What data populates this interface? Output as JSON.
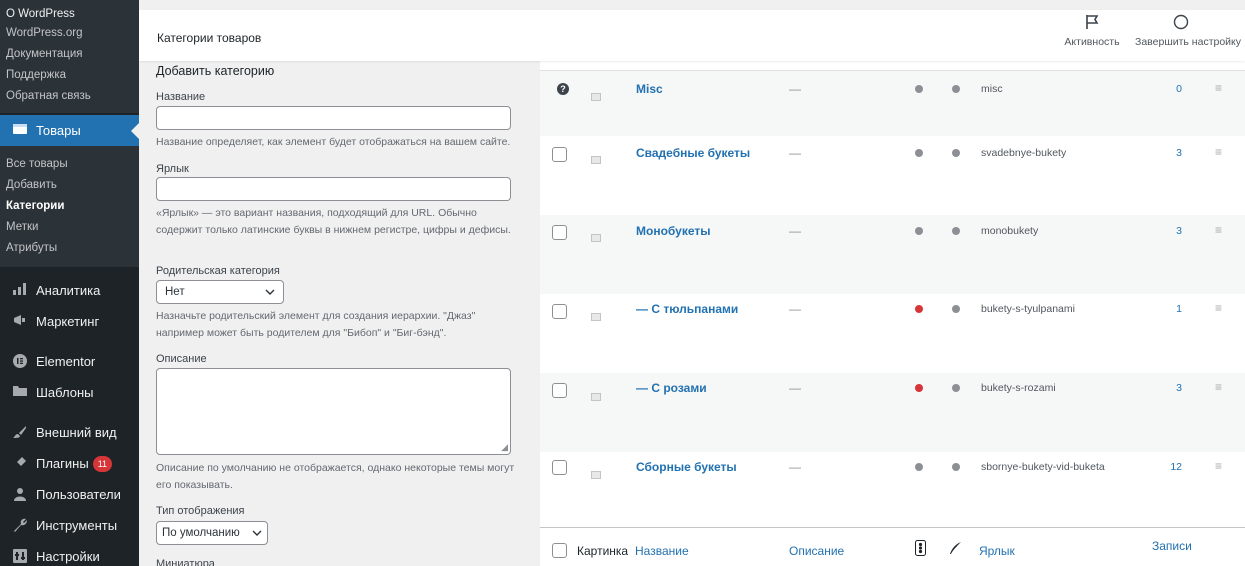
{
  "sidebar": {
    "top_sub": {
      "header": "О WordPress",
      "items": [
        "WordPress.org",
        "Документация",
        "Поддержка",
        "Обратная связь"
      ]
    },
    "active_menu": "Товары",
    "products_sub": [
      "Все товары",
      "Добавить",
      "Категории",
      "Метки",
      "Атрибуты"
    ],
    "current_sub": "Категории",
    "menu": [
      {
        "label": "Аналитика",
        "icon": "chart-bars-icon"
      },
      {
        "label": "Маркетинг",
        "icon": "megaphone-icon"
      },
      {
        "label": "Elementor",
        "icon": "elementor-icon"
      },
      {
        "label": "Шаблоны",
        "icon": "folder-icon"
      },
      {
        "label": "Внешний вид",
        "icon": "brush-icon"
      },
      {
        "label": "Плагины",
        "icon": "plugin-icon",
        "badge": "11"
      },
      {
        "label": "Пользователи",
        "icon": "user-icon"
      },
      {
        "label": "Инструменты",
        "icon": "wrench-icon"
      },
      {
        "label": "Настройки",
        "icon": "settings-icon"
      }
    ]
  },
  "header": {
    "title": "Категории товаров",
    "activity": "Активность",
    "finish_setup": "Завершить настройку"
  },
  "form": {
    "heading": "Добавить категорию",
    "name_label": "Название",
    "name_hint": "Название определяет, как элемент будет отображаться на вашем сайте.",
    "slug_label": "Ярлык",
    "slug_hint": "«Ярлык» — это вариант названия, подходящий для URL. Обычно содержит только латинские буквы в нижнем регистре, цифры и дефисы.",
    "parent_label": "Родительская категория",
    "parent_value": "Нет",
    "parent_hint": "Назначьте родительский элемент для создания иерархии. \"Джаз\" например может быть родителем для \"Бибоп\" и \"Биг-бэнд\".",
    "desc_label": "Описание",
    "desc_hint": "Описание по умолчанию не отображается, однако некоторые темы могут его показывать.",
    "display_label": "Тип отображения",
    "display_value": "По умолчанию",
    "thumb_label": "Миниатюра"
  },
  "table": {
    "rows": [
      {
        "name": "Misc",
        "desc": "—",
        "slug": "misc",
        "count": "0",
        "alt": true,
        "default": true,
        "dot_color": "#8c8f94"
      },
      {
        "name": "Свадебные букеты",
        "desc": "—",
        "slug": "svadebnye-bukety",
        "count": "3",
        "alt": false,
        "default": false,
        "dot_color": "#8c8f94"
      },
      {
        "name": "Монобукеты",
        "desc": "—",
        "slug": "monobukety",
        "count": "3",
        "alt": true,
        "default": false,
        "dot_color": "#8c8f94"
      },
      {
        "name": "— С тюльпанами",
        "desc": "—",
        "slug": "bukety-s-tyulpanami",
        "count": "1",
        "alt": false,
        "default": false,
        "dot_color": "#d63638"
      },
      {
        "name": "— С розами",
        "desc": "—",
        "slug": "bukety-s-rozami",
        "count": "3",
        "alt": true,
        "default": false,
        "dot_color": "#d63638"
      },
      {
        "name": "Сборные букеты",
        "desc": "—",
        "slug": "sbornye-bukety-vid-buketa",
        "count": "12",
        "alt": false,
        "default": false,
        "dot_color": "#8c8f94"
      }
    ],
    "footer": {
      "image": "Картинка",
      "name": "Название",
      "desc": "Описание",
      "slug": "Ярлык",
      "count": "Записи"
    }
  },
  "colors": {
    "accent": "#2271b1",
    "sidebar_bg": "#1d2327",
    "alert_red": "#d63638"
  }
}
